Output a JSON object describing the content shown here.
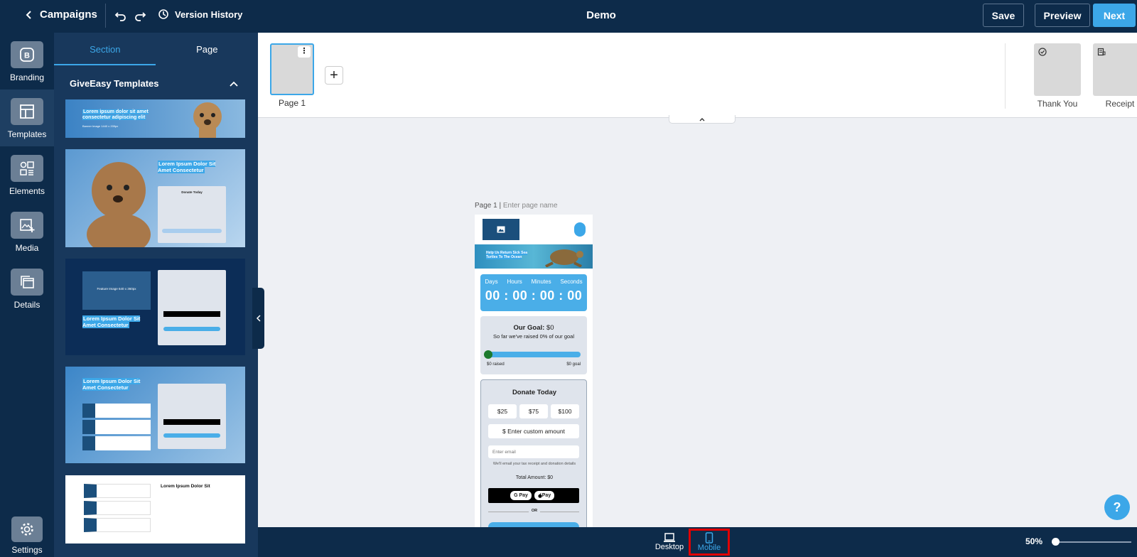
{
  "topbar": {
    "back_label": "Campaigns",
    "history_label": "Version History",
    "title": "Demo",
    "save_label": "Save",
    "preview_label": "Preview",
    "next_label": "Next"
  },
  "rail": {
    "items": [
      {
        "label": "Branding",
        "icon": "branding-icon"
      },
      {
        "label": "Templates",
        "icon": "templates-icon"
      },
      {
        "label": "Elements",
        "icon": "elements-icon"
      },
      {
        "label": "Media",
        "icon": "media-icon"
      },
      {
        "label": "Details",
        "icon": "details-icon"
      }
    ],
    "settings_label": "Settings",
    "active": "Templates"
  },
  "panel": {
    "tabs": [
      "Section",
      "Page"
    ],
    "active_tab": "Section",
    "heading": "GiveEasy Templates",
    "tpl_headline_1": "Lorem ipsum dolor sit amet consectetur adipiscing elit",
    "tpl_sub_1": "Banner Image 1440 x 209px",
    "tpl_headline_2": "Lorem Ipsum Dolor Sit Amet Consectetur",
    "tpl_donate": "Donate Today",
    "tpl_feature": "Feature Image 640 x 360px",
    "tpl_headline_3": "Lorem Ipsum Dolor Sit"
  },
  "pages": {
    "page1_label": "Page 1",
    "thank_you_label": "Thank You",
    "receipt_label": "Receipt"
  },
  "canvas": {
    "page_prefix": "Page 1 |",
    "page_name_placeholder": "Enter page name",
    "banner_text": "Help Us Return Sick Sea Turtles To The Ocean",
    "countdown_labels": [
      "Days",
      "Hours",
      "Minutes",
      "Seconds"
    ],
    "countdown_value": "00 : 00 : 00 : 00",
    "goal_title": "Our Goal:",
    "goal_amount": "$0",
    "goal_sub": "So far we've raised 0% of our goal",
    "goal_progress": 0,
    "raised_label": "$0 raised",
    "goal_label": "$0 goal",
    "donate_title": "Donate Today",
    "amounts": [
      "$25",
      "$75",
      "$100"
    ],
    "custom_amount": "$ Enter custom amount",
    "email_placeholder": "Enter email",
    "email_note": "We'll email your tax receipt and donation details",
    "total_label": "Total Amount:",
    "total_value": "$0",
    "gpay_label": "G Pay",
    "apay_label": "Pay",
    "or_label": "OR"
  },
  "bottombar": {
    "desktop_label": "Desktop",
    "mobile_label": "Mobile",
    "active_device": "Mobile",
    "zoom": "50%"
  },
  "help_label": "?",
  "colors": {
    "navy": "#0d2b4a",
    "panel": "#18385c",
    "accent": "#3ca7e8",
    "highlight": "#e10000"
  }
}
